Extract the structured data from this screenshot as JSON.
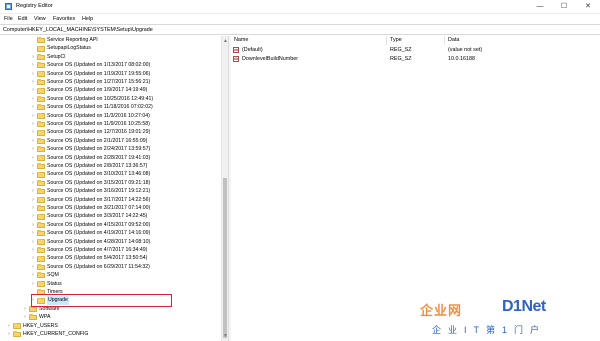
{
  "window": {
    "title": "Registry Editor",
    "controls": {
      "minimize": "—",
      "maximize": "☐",
      "close": "✕"
    }
  },
  "menu": [
    "File",
    "Edit",
    "View",
    "Favorites",
    "Help"
  ],
  "address": "Computer\\HKEY_LOCAL_MACHINE\\SYSTEM\\Setup\\Upgrade",
  "tree": {
    "items": [
      {
        "label": "Service Reporting API",
        "expander": ""
      },
      {
        "label": "SetupapiLogStatus",
        "expander": ""
      },
      {
        "label": "SetupCl",
        "expander": "›"
      },
      {
        "label": "Source OS (Updated on 1/13/2017 08:02:00)",
        "expander": "›"
      },
      {
        "label": "Source OS (Updated on 1/19/2017 19:55:06)",
        "expander": "›"
      },
      {
        "label": "Source OS (Updated on 1/27/2017 15:56:21)",
        "expander": "›"
      },
      {
        "label": "Source OS (Updated on 1/9/2017 14:19:49)",
        "expander": "›"
      },
      {
        "label": "Source OS (Updated on 10/25/2016 12:49:41)",
        "expander": "›"
      },
      {
        "label": "Source OS (Updated on 11/18/2016 07:02:02)",
        "expander": "›"
      },
      {
        "label": "Source OS (Updated on 11/3/2016 10:27:04)",
        "expander": "›"
      },
      {
        "label": "Source OS (Updated on 11/9/2016 10:25:58)",
        "expander": "›"
      },
      {
        "label": "Source OS (Updated on 12/7/2016 19:01:29)",
        "expander": "›"
      },
      {
        "label": "Source OS (Updated on 2/1/2017 16:55:09)",
        "expander": "›"
      },
      {
        "label": "Source OS (Updated on 2/24/2017 13:59:57)",
        "expander": "›"
      },
      {
        "label": "Source OS (Updated on 2/28/2017 19:41:03)",
        "expander": "›"
      },
      {
        "label": "Source OS (Updated on 2/8/2017 13:36:57)",
        "expander": "›"
      },
      {
        "label": "Source OS (Updated on 3/10/2017 13:46:08)",
        "expander": "›"
      },
      {
        "label": "Source OS (Updated on 3/15/2017 09:21:18)",
        "expander": "›"
      },
      {
        "label": "Source OS (Updated on 3/16/2017 19:12:21)",
        "expander": "›"
      },
      {
        "label": "Source OS (Updated on 3/17/2017 14:22:56)",
        "expander": "›"
      },
      {
        "label": "Source OS (Updated on 3/21/2017 07:14:00)",
        "expander": "›"
      },
      {
        "label": "Source OS (Updated on 3/3/2017 14:22:45)",
        "expander": "›"
      },
      {
        "label": "Source OS (Updated on 4/15/2017 09:52:00)",
        "expander": "›"
      },
      {
        "label": "Source OS (Updated on 4/19/2017 14:16:09)",
        "expander": "›"
      },
      {
        "label": "Source OS (Updated on 4/28/2017 14:08:10)",
        "expander": "›"
      },
      {
        "label": "Source OS (Updated on 4/7/2017 16:34:49)",
        "expander": "›"
      },
      {
        "label": "Source OS (Updated on 5/4/2017 13:50:54)",
        "expander": "›"
      },
      {
        "label": "Source OS (Updated on 6/29/2017 11:54:32)",
        "expander": "›"
      },
      {
        "label": "SQM",
        "expander": "›"
      },
      {
        "label": "Status",
        "expander": "›"
      },
      {
        "label": "Timers",
        "expander": ""
      },
      {
        "label": "Upgrade",
        "expander": "›",
        "selected": true
      },
      {
        "label": "Software",
        "expander": "›"
      },
      {
        "label": "WPA",
        "expander": "›"
      },
      {
        "label": "HKEY_USERS",
        "expander": "›"
      },
      {
        "label": "HKEY_CURRENT_CONFIG",
        "expander": "›"
      }
    ]
  },
  "list": {
    "columns": [
      "Name",
      "Type",
      "Data"
    ],
    "rows": [
      {
        "icon": "string-value-icon",
        "icon_glyph": "ab",
        "name": "(Default)",
        "type": "REG_SZ",
        "data": "(value not set)"
      },
      {
        "icon": "string-value-icon",
        "icon_glyph": "ab",
        "name": "DownlevelBuildNumber",
        "type": "REG_SZ",
        "data": "10.0.16188"
      }
    ]
  },
  "watermark": {
    "line1": "企业网",
    "brand": "D1Net",
    "line2": "企业IT第1门户"
  },
  "colors": {
    "folder": "#f7d56b",
    "selection": "#cce8ff",
    "highlight_border": "#d8232f",
    "watermark_orange": "#f09040",
    "watermark_blue": "#2f63c4"
  }
}
